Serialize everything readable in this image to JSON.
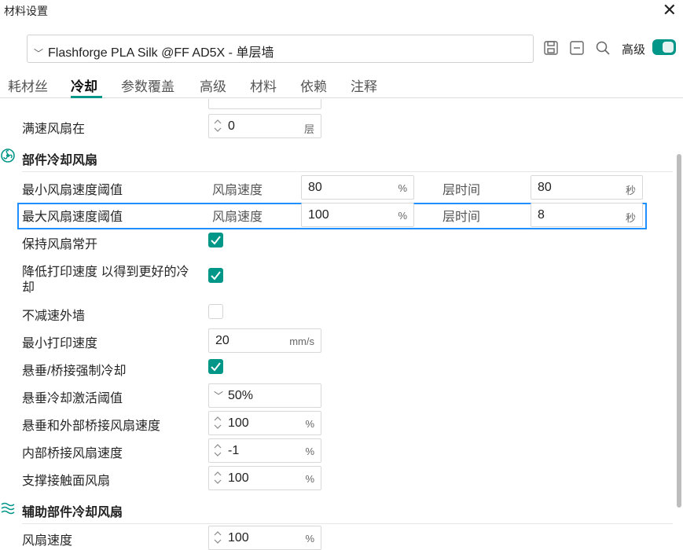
{
  "window": {
    "title": "材料设置",
    "close": "✕"
  },
  "preset": {
    "name": "Flashforge PLA Silk @FF AD5X - 单层墙"
  },
  "toolbar": {
    "advanced_label": "高级"
  },
  "tabs": [
    {
      "label": "耗材丝"
    },
    {
      "label": "冷却"
    },
    {
      "label": "参数覆盖"
    },
    {
      "label": "高级"
    },
    {
      "label": "材料"
    },
    {
      "label": "依赖"
    },
    {
      "label": "注释"
    }
  ],
  "settings": {
    "full_fan_at": {
      "label": "满速风扇在",
      "value": "0",
      "unit": "层"
    },
    "part_cooling_section": "部件冷却风扇",
    "min_fan_threshold": {
      "label": "最小风扇速度阈值",
      "fan_label": "风扇速度",
      "fan_value": "80",
      "fan_unit": "%",
      "time_label": "层时间",
      "time_value": "80",
      "time_unit": "秒"
    },
    "max_fan_threshold": {
      "label": "最大风扇速度阈值",
      "fan_label": "风扇速度",
      "fan_value": "100",
      "fan_unit": "%",
      "time_label": "层时间",
      "time_value": "8",
      "time_unit": "秒"
    },
    "keep_fan_on": {
      "label": "保持风扇常开",
      "checked": true
    },
    "slow_down_cooling": {
      "label_line1": "降低打印速度 以得到更好的冷",
      "label_line2": "却",
      "checked": true
    },
    "no_slow_outer_wall": {
      "label": "不减速外墙",
      "checked": false
    },
    "min_print_speed": {
      "label": "最小打印速度",
      "value": "20",
      "unit": "mm/s"
    },
    "overhang_force_cooling": {
      "label": "悬垂/桥接强制冷却",
      "checked": true
    },
    "overhang_threshold": {
      "label": "悬垂冷却激活阈值",
      "value": "50%"
    },
    "overhang_bridge_fan": {
      "label": "悬垂和外部桥接风扇速度",
      "value": "100",
      "unit": "%"
    },
    "internal_bridge_fan": {
      "label": "内部桥接风扇速度",
      "value": "-1",
      "unit": "%"
    },
    "support_interface_fan": {
      "label": "支撑接触面风扇",
      "value": "100",
      "unit": "%"
    },
    "aux_fan_section": "辅助部件冷却风扇",
    "aux_fan_speed": {
      "label": "风扇速度",
      "value": "100",
      "unit": "%"
    }
  },
  "colors": {
    "accent": "#009688",
    "highlight": "#1e90ff"
  }
}
